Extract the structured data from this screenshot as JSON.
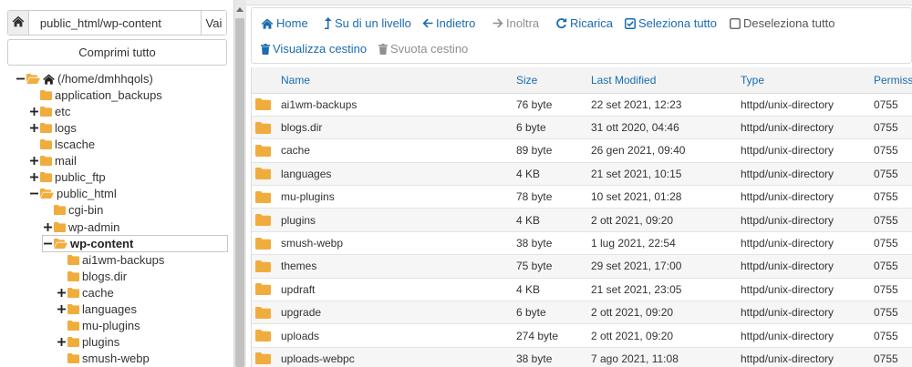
{
  "path_bar": {
    "value": "public_html/wp-content",
    "go_label": "Vai"
  },
  "collapse_all_label": "Comprimi tutto",
  "tree": [
    {
      "label": "(/home/dmhhqols)",
      "toggle": "minus",
      "home": true,
      "open": true
    },
    {
      "label": "application_backups",
      "toggle": "none"
    },
    {
      "label": "etc",
      "toggle": "plus"
    },
    {
      "label": "logs",
      "toggle": "plus"
    },
    {
      "label": "lscache",
      "toggle": "none"
    },
    {
      "label": "mail",
      "toggle": "plus"
    },
    {
      "label": "public_ftp",
      "toggle": "plus"
    },
    {
      "label": "public_html",
      "toggle": "minus",
      "open": true
    },
    {
      "label": "cgi-bin",
      "toggle": "none"
    },
    {
      "label": "wp-admin",
      "toggle": "plus"
    },
    {
      "label": "wp-content",
      "toggle": "minus",
      "open": true,
      "selected": true
    },
    {
      "label": "ai1wm-backups",
      "toggle": "none"
    },
    {
      "label": "blogs.dir",
      "toggle": "none"
    },
    {
      "label": "cache",
      "toggle": "plus"
    },
    {
      "label": "languages",
      "toggle": "plus"
    },
    {
      "label": "mu-plugins",
      "toggle": "none"
    },
    {
      "label": "plugins",
      "toggle": "plus"
    },
    {
      "label": "smush-webp",
      "toggle": "none"
    }
  ],
  "toolbar": {
    "home": "Home",
    "up": "Su di un livello",
    "back": "Indietro",
    "forward": "Inoltra",
    "reload": "Ricarica",
    "select_all": "Seleziona tutto",
    "deselect_all": "Deseleziona tutto",
    "view_trash": "Visualizza cestino",
    "empty_trash": "Svuota cestino"
  },
  "table": {
    "headers": {
      "name": "Name",
      "size": "Size",
      "modified": "Last Modified",
      "type": "Type",
      "perms": "Permiss"
    },
    "rows": [
      {
        "name": "ai1wm-backups",
        "size": "76 byte",
        "modified": "22 set 2021, 12:23",
        "type": "httpd/unix-directory",
        "perms": "0755"
      },
      {
        "name": "blogs.dir",
        "size": "6 byte",
        "modified": "31 ott 2020, 04:46",
        "type": "httpd/unix-directory",
        "perms": "0755"
      },
      {
        "name": "cache",
        "size": "89 byte",
        "modified": "26 gen 2021, 09:40",
        "type": "httpd/unix-directory",
        "perms": "0755"
      },
      {
        "name": "languages",
        "size": "4 KB",
        "modified": "21 set 2021, 10:15",
        "type": "httpd/unix-directory",
        "perms": "0755"
      },
      {
        "name": "mu-plugins",
        "size": "78 byte",
        "modified": "10 set 2021, 01:28",
        "type": "httpd/unix-directory",
        "perms": "0755"
      },
      {
        "name": "plugins",
        "size": "4 KB",
        "modified": "2 ott 2021, 09:20",
        "type": "httpd/unix-directory",
        "perms": "0755"
      },
      {
        "name": "smush-webp",
        "size": "38 byte",
        "modified": "1 lug 2021, 22:54",
        "type": "httpd/unix-directory",
        "perms": "0755"
      },
      {
        "name": "themes",
        "size": "75 byte",
        "modified": "29 set 2021, 17:00",
        "type": "httpd/unix-directory",
        "perms": "0755"
      },
      {
        "name": "updraft",
        "size": "4 KB",
        "modified": "21 set 2021, 23:05",
        "type": "httpd/unix-directory",
        "perms": "0755"
      },
      {
        "name": "upgrade",
        "size": "6 byte",
        "modified": "2 ott 2021, 09:20",
        "type": "httpd/unix-directory",
        "perms": "0755"
      },
      {
        "name": "uploads",
        "size": "274 byte",
        "modified": "2 ott 2021, 09:20",
        "type": "httpd/unix-directory",
        "perms": "0755"
      },
      {
        "name": "uploads-webpc",
        "size": "38 byte",
        "modified": "7 ago 2021, 11:08",
        "type": "httpd/unix-directory",
        "perms": "0755"
      }
    ]
  },
  "colors": {
    "link": "#1a6bb0",
    "folder": "#f0ad3e",
    "disabled": "#8f8f8f"
  }
}
